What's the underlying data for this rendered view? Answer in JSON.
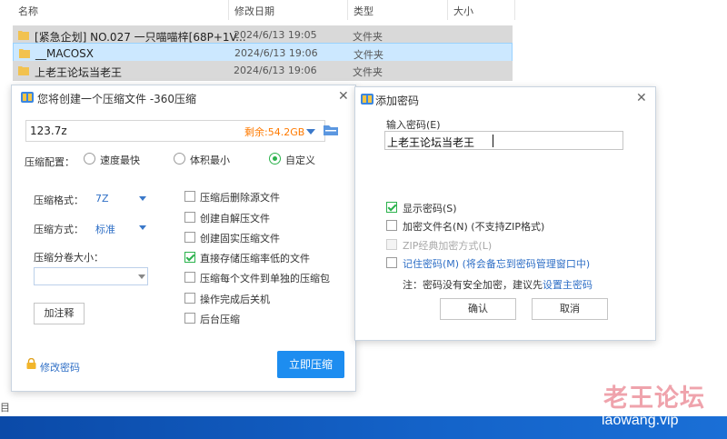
{
  "explorer": {
    "columns": {
      "name": "名称",
      "date": "修改日期",
      "type": "类型",
      "size": "大小"
    },
    "rows": [
      {
        "name": "[紧急企划] NO.027 一只喵喵梓[68P+1V...",
        "date": "2024/6/13 19:05",
        "type": "文件夹"
      },
      {
        "name": "__MACOSX",
        "date": "2024/6/13 19:06",
        "type": "文件夹"
      },
      {
        "name": "上老王论坛当老王",
        "date": "2024/6/13 19:06",
        "type": "文件夹"
      }
    ],
    "side_text": "目"
  },
  "compress_dialog": {
    "title": "您将创建一个压缩文件 -360压缩",
    "filename": "123.7z",
    "remaining": "剩余:54.2GB",
    "config_label": "压缩配置：",
    "modes": [
      "速度最快",
      "体积最小",
      "自定义"
    ],
    "format_label": "压缩格式：",
    "format_value": "7Z",
    "method_label": "压缩方式：",
    "method_value": "标准",
    "volume_label": "压缩分卷大小：",
    "comment_button": "加注释",
    "options": [
      "压缩后删除源文件",
      "创建自解压文件",
      "创建固实压缩文件",
      "直接存储压缩率低的文件",
      "压缩每个文件到单独的压缩包",
      "操作完成后关机",
      "后台压缩"
    ],
    "change_password": "修改密码",
    "compress_now": "立即压缩"
  },
  "password_dialog": {
    "title": "添加密码",
    "input_label": "输入密码(E)",
    "password_value": "上老王论坛当老王",
    "show_password": "显示密码(S)",
    "encrypt_names": "加密文件名(N) (不支持ZIP格式)",
    "zip_classic": "ZIP经典加密方式(L)",
    "remember": "记住密码(M) (将会备忘到密码管理窗口中)",
    "note_prefix": "注：密码没有安全加密，建议先",
    "note_link": "设置主密码",
    "ok": "确认",
    "cancel": "取消"
  },
  "watermark": {
    "text": "老王论坛",
    "url": "laowang.vip"
  }
}
